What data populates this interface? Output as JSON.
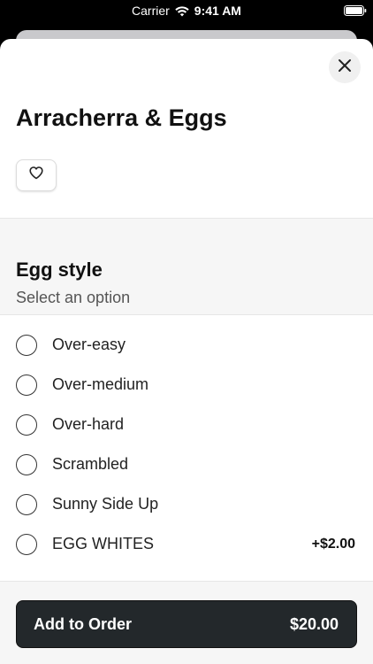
{
  "status_bar": {
    "carrier": "Carrier",
    "time": "9:41 AM",
    "wifi_icon": "wifi-icon",
    "battery_icon": "battery-icon"
  },
  "item": {
    "title": "Arracherra & Eggs",
    "favorite_icon": "heart-icon",
    "close_icon": "close-icon"
  },
  "modifier_group": {
    "title": "Egg style",
    "subtitle": "Select an option",
    "options": [
      {
        "label": "Over-easy",
        "price": ""
      },
      {
        "label": "Over-medium",
        "price": ""
      },
      {
        "label": "Over-hard",
        "price": ""
      },
      {
        "label": "Scrambled",
        "price": ""
      },
      {
        "label": "Sunny Side Up",
        "price": ""
      },
      {
        "label": "EGG WHITES",
        "price": "+$2.00"
      }
    ]
  },
  "order_button": {
    "label": "Add to Order",
    "price": "$20.00"
  },
  "colors": {
    "button_bg": "#23282b",
    "section_bg": "#f6f6f6",
    "close_bg": "#f0f0f0"
  }
}
